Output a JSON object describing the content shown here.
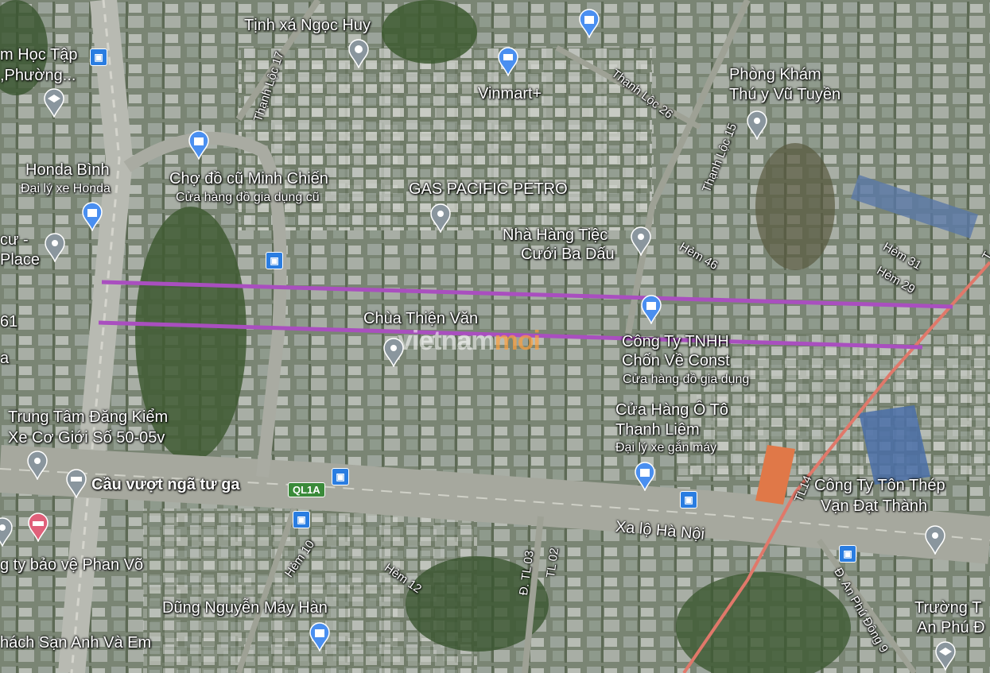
{
  "places": {
    "tinh_xa": "Tịnh xá Ngọc Huy",
    "vinmart": "Vinmart+",
    "hoc_tap_1": "m Học Tập",
    "hoc_tap_2": ",Phường...",
    "phong_kham_1": "Phòng Khám",
    "phong_kham_2": "Thú y Vũ Tuyền",
    "honda_1": "Honda Bình",
    "honda_2": "Đại lý xe Honda",
    "cho_1": "Chợ đồ cũ Minh Chiến",
    "cho_2": "Cửa hàng đồ gia dụng cũ",
    "gas": "GAS PACIFIC PETRO",
    "nha_hang_1": "Nhà Hàng Tiệc",
    "nha_hang_2": "Cưới Ba Dấu",
    "cu_1": "cư -",
    "cu_2": "Place",
    "num_61": "61",
    "letter_a": "a",
    "chua": "Chùa Thiện Văn",
    "cong_ty_1": "Công Ty TNHH",
    "cong_ty_2": "Chốn Về Const",
    "cong_ty_3": "Cửa hàng đồ gia dụng",
    "trung_tam_1": "Trung Tâm Đăng Kiểm",
    "trung_tam_2": "Xe Cơ Giới Số 50-05v",
    "cua_hang_oto_1": "Cửa Hàng Ô Tô",
    "cua_hang_oto_2": "Thanh Liêm",
    "cua_hang_oto_3": "Đại lý xe gắn máy",
    "cau_vuot": "Cầu vượt ngã tư ga",
    "ton_thep_1": "Công Ty Tôn Thép",
    "ton_thep_2": "Vạn Đạt Thành",
    "bao_ve": "g ty bảo vệ Phan Võ",
    "dung_nguyen": "Dũng Nguyễn Máy Hàn",
    "khach_san": "hách Sạn Anh Và Em",
    "truong_1": "Trường T",
    "truong_2": "An Phú Đ"
  },
  "roads": {
    "thanh_loc_17": "Thạnh Lộc 17",
    "thanh_loc_26": "Thạnh Lộc 26",
    "thanh_loc_15": "Thạnh Lộc 15",
    "hem_46": "Hẻm 46",
    "hem_31": "Hẻm 31",
    "hem_29": "Hẻm 29",
    "xa_lo": "Xa lộ Hà Nội",
    "tl14": "TL14",
    "hem_10": "Hẻm 10",
    "hem_12": "Hẻm 12",
    "tl03": "Đ. TL 03",
    "tl02": "TL 02",
    "an_phu": "Đ. An Phú Đông 9",
    "ql1a": "QL1A",
    "t_edge": "T"
  },
  "watermark": {
    "part1": "vietnam",
    "part2": "moi"
  },
  "colors": {
    "route": "#a94fbf",
    "pin_blue": "#4a8ff0",
    "pin_gray": "#8a969e",
    "pin_pink": "#e0607a",
    "rail": "#e0786a"
  }
}
